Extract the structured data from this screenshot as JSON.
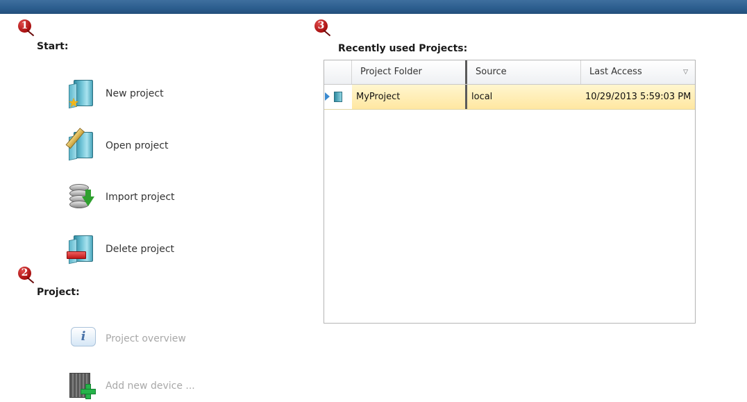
{
  "markers": {
    "start": "1",
    "project": "2",
    "recent": "3"
  },
  "start": {
    "title": "Start:",
    "actions": [
      {
        "label": "New project",
        "icon": "new-project-icon"
      },
      {
        "label": "Open project",
        "icon": "open-project-icon"
      },
      {
        "label": "Import project",
        "icon": "import-project-icon"
      },
      {
        "label": "Delete project",
        "icon": "delete-project-icon"
      }
    ]
  },
  "project": {
    "title": "Project:",
    "actions": [
      {
        "label": "Project overview",
        "icon": "info-icon",
        "enabled": false
      },
      {
        "label": "Add new device ...",
        "icon": "add-device-icon",
        "enabled": false
      }
    ]
  },
  "recent": {
    "title": "Recently used Projects:",
    "columns": [
      "Project Folder",
      "Source",
      "Last Access"
    ],
    "rows": [
      {
        "folder": "MyProject",
        "source": "local",
        "last_access": "10/29/2013 5:59:03 PM",
        "selected": true
      }
    ]
  },
  "colors": {
    "topbar": "#2b5d8e",
    "selection": "#ffe7a1",
    "marker": "#b01414"
  }
}
